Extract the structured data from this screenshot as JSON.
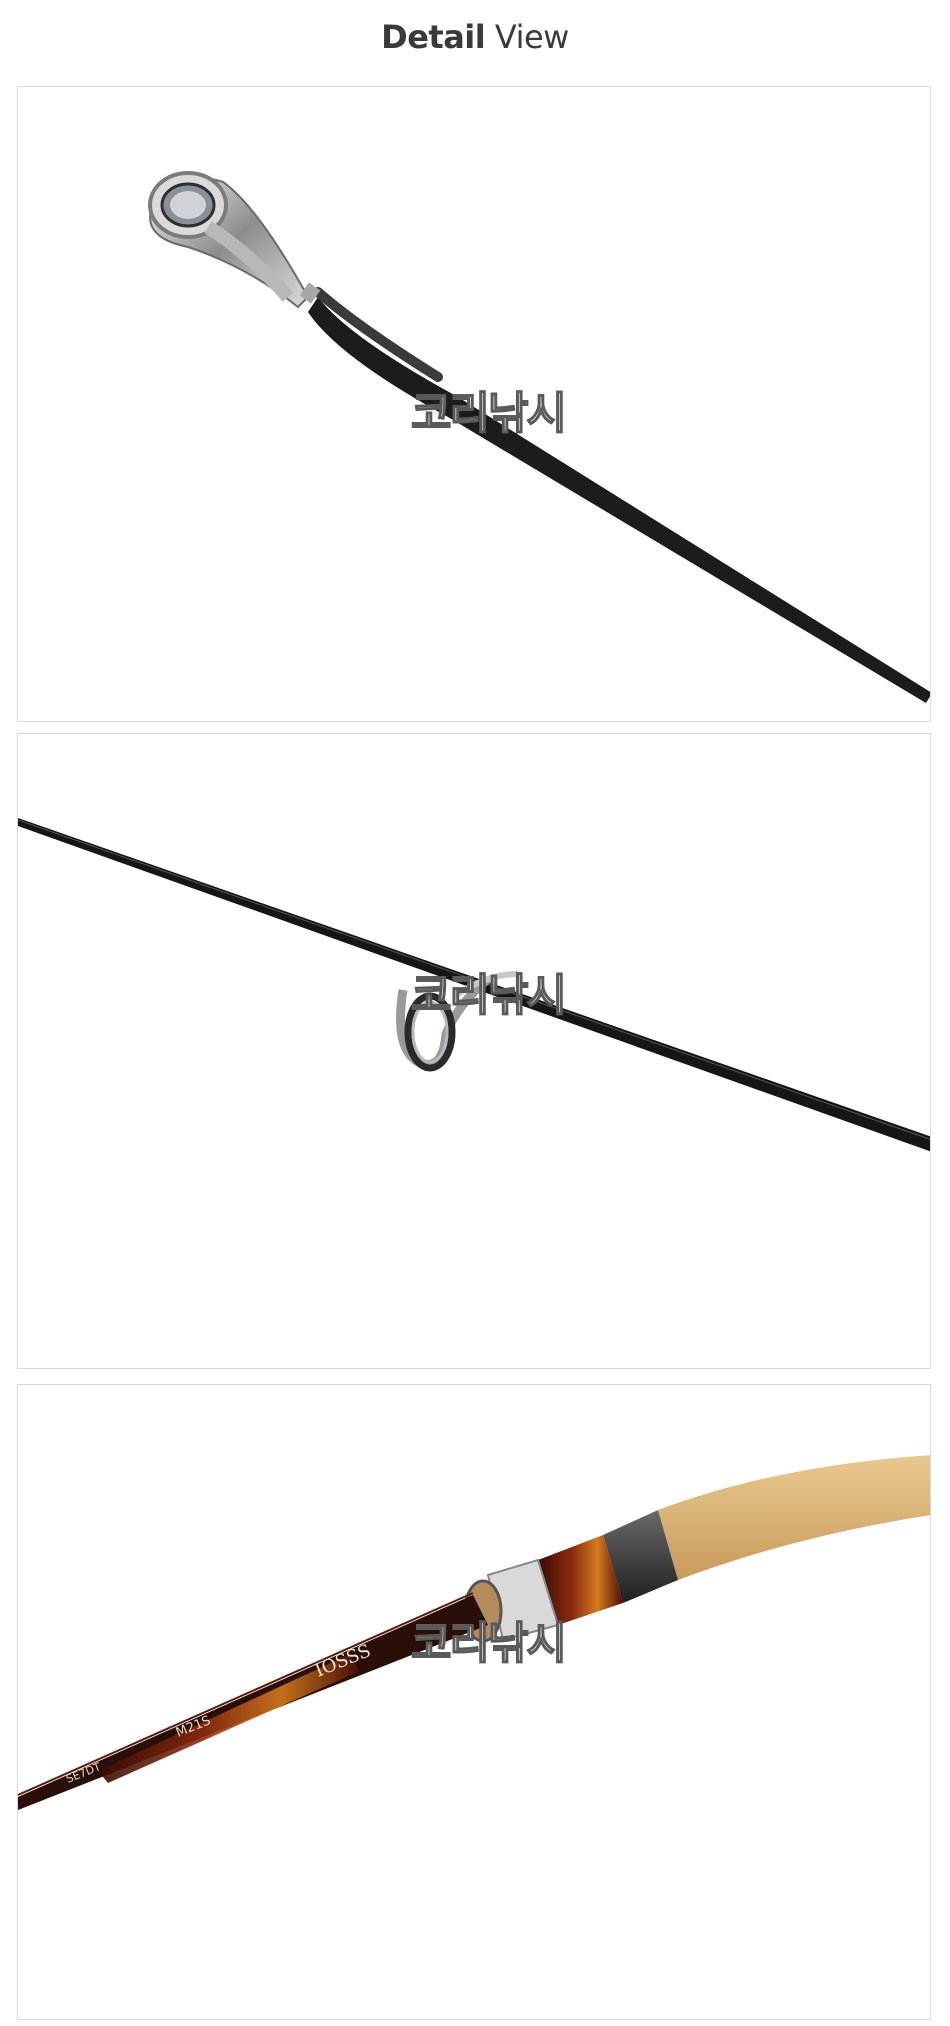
{
  "heading": {
    "bold": "Detail",
    "rest": " View"
  },
  "panels": [
    {
      "name": "tip-guide-detail",
      "watermark": "코리낚시",
      "icon": "rod-tip-guide-photo"
    },
    {
      "name": "line-guide-detail",
      "watermark": "코리낚시",
      "icon": "rod-line-guide-photo"
    },
    {
      "name": "reel-seat-grip-detail",
      "watermark": "코리낚시",
      "icon": "rod-handle-photo",
      "rod_text": [
        "IOSSS",
        "M21S",
        "SE7DT"
      ]
    }
  ],
  "colors": {
    "background": "#ffffff",
    "border": "#d9d9d9",
    "heading": "#3a3a3a",
    "cork": "#d8b07a",
    "blank": "#1a1a1a"
  }
}
